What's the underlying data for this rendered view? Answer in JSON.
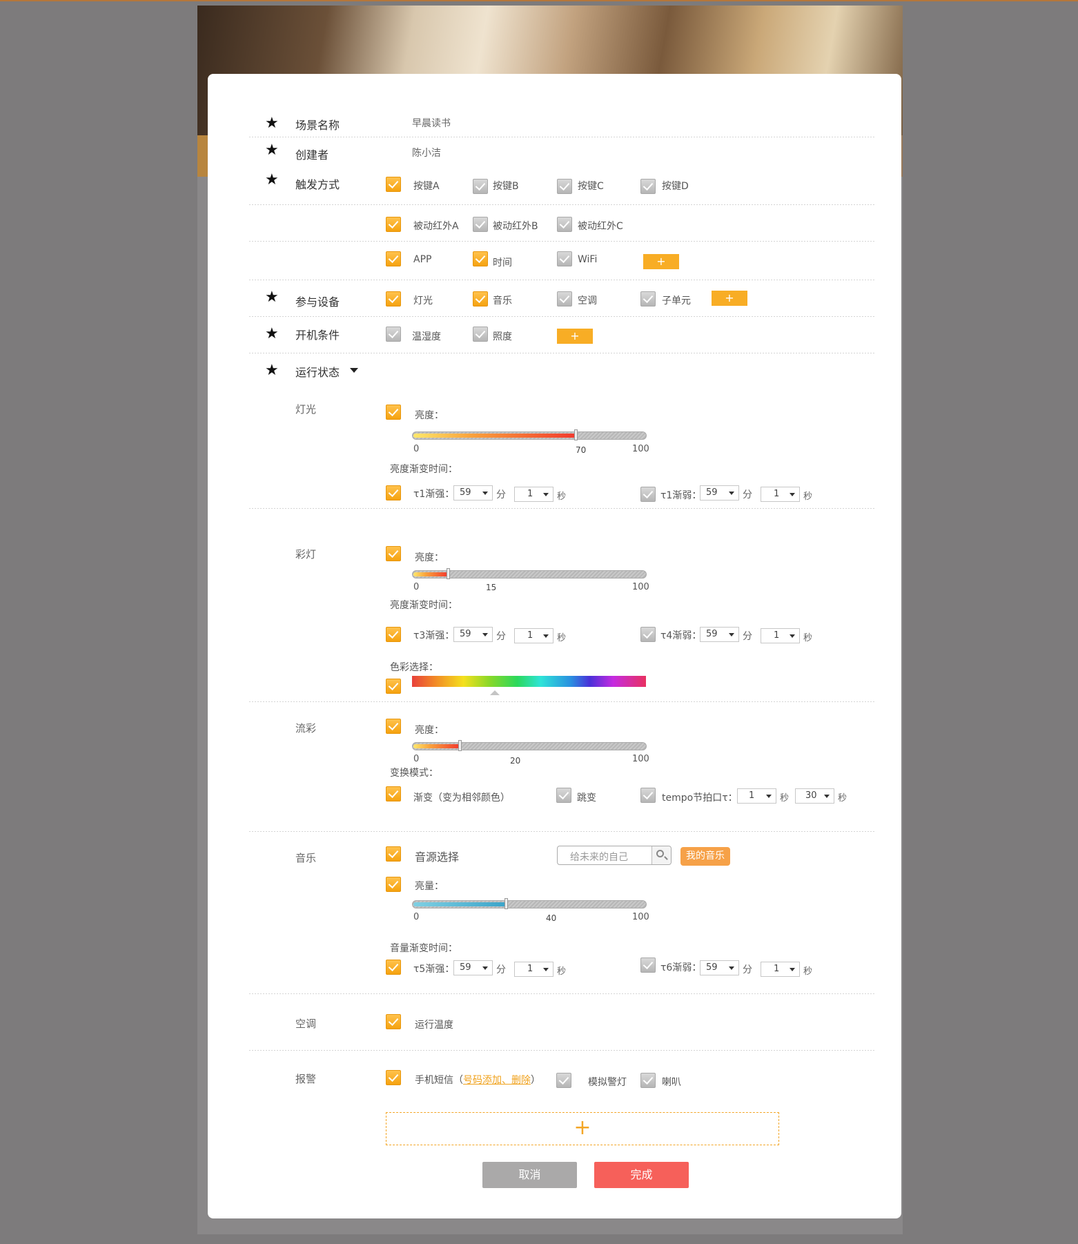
{
  "form": {
    "scene_name_label": "场景名称",
    "scene_name_value": "早晨读书",
    "creator_label": "创建者",
    "creator_value": "陈小洁",
    "trigger_label": "触发方式",
    "trigger_options": [
      "按键A",
      "按键B",
      "按键C",
      "按键D",
      "被动红外A",
      "被动红外B",
      "被动红外C",
      "APP",
      "时间",
      "WiFi"
    ],
    "devices_label": "参与设备",
    "device_options": [
      "灯光",
      "音乐",
      "空调",
      "子单元"
    ],
    "power_condition_label": "开机条件",
    "power_condition_options": [
      "温湿度",
      "照度"
    ],
    "run_state_label": "运行状态",
    "plus": "+"
  },
  "light": {
    "title": "灯光",
    "brightness_label": "亮度：",
    "brightness": 70,
    "min": "0",
    "max": "100",
    "fade_label": "亮度渐变时间：",
    "fade_in_label": "τ1渐强：",
    "fade_out_label": "τ1渐弱：",
    "minutes": "59",
    "seconds": "1",
    "unit_min": "分",
    "unit_sec": "秒"
  },
  "color_light": {
    "title": "彩灯",
    "brightness_label": "亮度：",
    "brightness": 15,
    "min": "0",
    "max": "100",
    "fade_label": "亮度渐变时间：",
    "fade_in_label": "τ3渐强：",
    "fade_out_label": "τ4渐弱：",
    "minutes": "59",
    "seconds": "1",
    "unit_min": "分",
    "unit_sec": "秒",
    "color_label": "色彩选择："
  },
  "flow_color": {
    "title": "流彩",
    "brightness_label": "亮度：",
    "brightness": 20,
    "min": "0",
    "max": "100",
    "mode_label": "变换模式：",
    "mode_gradient": "渐变（变为相邻颜色）",
    "mode_jump": "跳变",
    "mode_tempo": "tempo节拍口τ：",
    "tempo_value": "1",
    "tempo_value2": "30",
    "unit_sec": "秒"
  },
  "music": {
    "title": "音乐",
    "source_label": "音源选择",
    "search_placeholder": "给未来的自己",
    "my_music": "我的音乐",
    "volume_label": "亮量：",
    "volume": 40,
    "min": "0",
    "max": "100",
    "fade_label": "音量渐变时间：",
    "fade_in_label": "τ5渐强：",
    "fade_out_label": "τ6渐弱：",
    "minutes": "59",
    "seconds": "1",
    "unit_min": "分",
    "unit_sec": "秒"
  },
  "aircon": {
    "title": "空调",
    "run_temp": "运行温度"
  },
  "alarm": {
    "title": "报警",
    "sms": "手机短信（",
    "sms_link": "号码添加、删除",
    "sms_end": "）",
    "police_light": "模拟警灯",
    "horn": "喇叭"
  },
  "actions": {
    "add": "+",
    "cancel": "取消",
    "done": "完成"
  }
}
